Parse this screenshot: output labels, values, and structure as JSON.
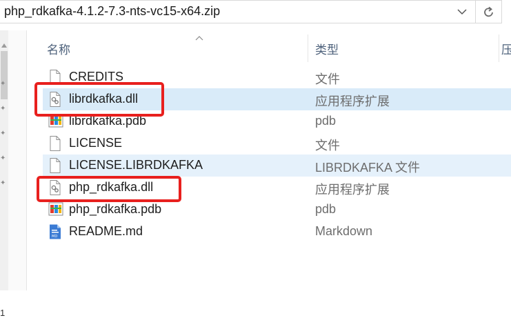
{
  "address": {
    "path": "php_rdkafka-4.1.2-7.3-nts-vc15-x64.zip"
  },
  "sidebar": {
    "corner_text": "1"
  },
  "columns": {
    "name": "名称",
    "type": "类型",
    "third": "压"
  },
  "files": [
    {
      "name": "CREDITS",
      "type": "文件",
      "icon": "file-icon"
    },
    {
      "name": "librdkafka.dll",
      "type": "应用程序扩展",
      "icon": "dll-icon"
    },
    {
      "name": "librdkafka.pdb",
      "type": "pdb",
      "icon": "pdb-icon"
    },
    {
      "name": "LICENSE",
      "type": "文件",
      "icon": "file-icon"
    },
    {
      "name": "LICENSE.LIBRDKAFKA",
      "type": "LIBRDKAFKA 文件",
      "icon": "file-icon"
    },
    {
      "name": "php_rdkafka.dll",
      "type": "应用程序扩展",
      "icon": "dll-icon"
    },
    {
      "name": "php_rdkafka.pdb",
      "type": "pdb",
      "icon": "pdb-icon"
    },
    {
      "name": "README.md",
      "type": "Markdown",
      "icon": "markdown-icon"
    }
  ],
  "colors": {
    "highlight": "#e8201e",
    "selected": "#d9ebf9",
    "hover": "#e5f1fb",
    "header_text": "#4c607a"
  }
}
